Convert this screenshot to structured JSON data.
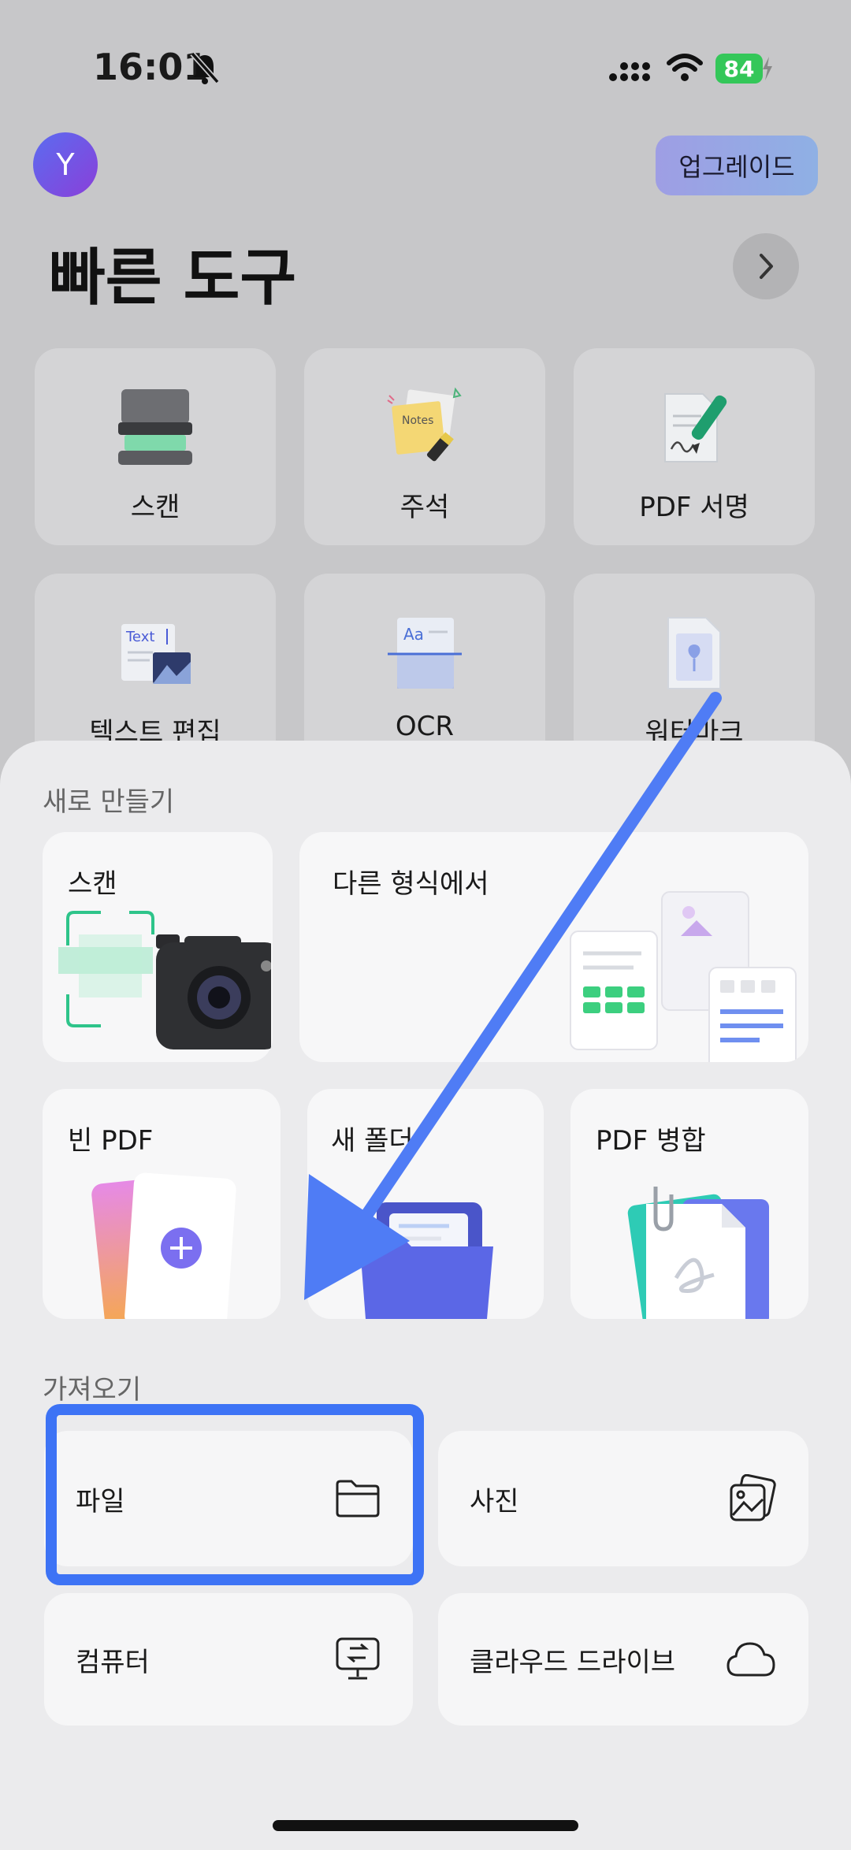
{
  "status_bar": {
    "time": "16:01",
    "battery": "84"
  },
  "header": {
    "avatar_letter": "Y",
    "upgrade_label": "업그레이드",
    "title": "빠른 도구"
  },
  "quick_tools": [
    {
      "label": "스캔",
      "icon": "scanner-icon"
    },
    {
      "label": "주석",
      "icon": "notes-icon"
    },
    {
      "label": "PDF 서명",
      "icon": "signature-icon"
    },
    {
      "label": "텍스트 편집",
      "icon": "text-edit-icon"
    },
    {
      "label": "OCR",
      "icon": "ocr-icon"
    },
    {
      "label": "워터마크",
      "icon": "watermark-icon"
    }
  ],
  "create": {
    "section_title": "새로 만들기",
    "items": [
      {
        "label": "스캔"
      },
      {
        "label": "다른 형식에서"
      },
      {
        "label": "빈 PDF"
      },
      {
        "label": "새 폴더"
      },
      {
        "label": "PDF 병합"
      }
    ]
  },
  "import": {
    "section_title": "가져오기",
    "items": [
      {
        "label": "파일",
        "icon": "folder-icon"
      },
      {
        "label": "사진",
        "icon": "photo-icon"
      },
      {
        "label": "컴퓨터",
        "icon": "computer-transfer-icon"
      },
      {
        "label": "클라우드 드라이브",
        "icon": "cloud-icon"
      }
    ]
  },
  "colors": {
    "highlight": "#3d73f5",
    "arrow": "#4f7cf5",
    "battery": "#34c759"
  }
}
